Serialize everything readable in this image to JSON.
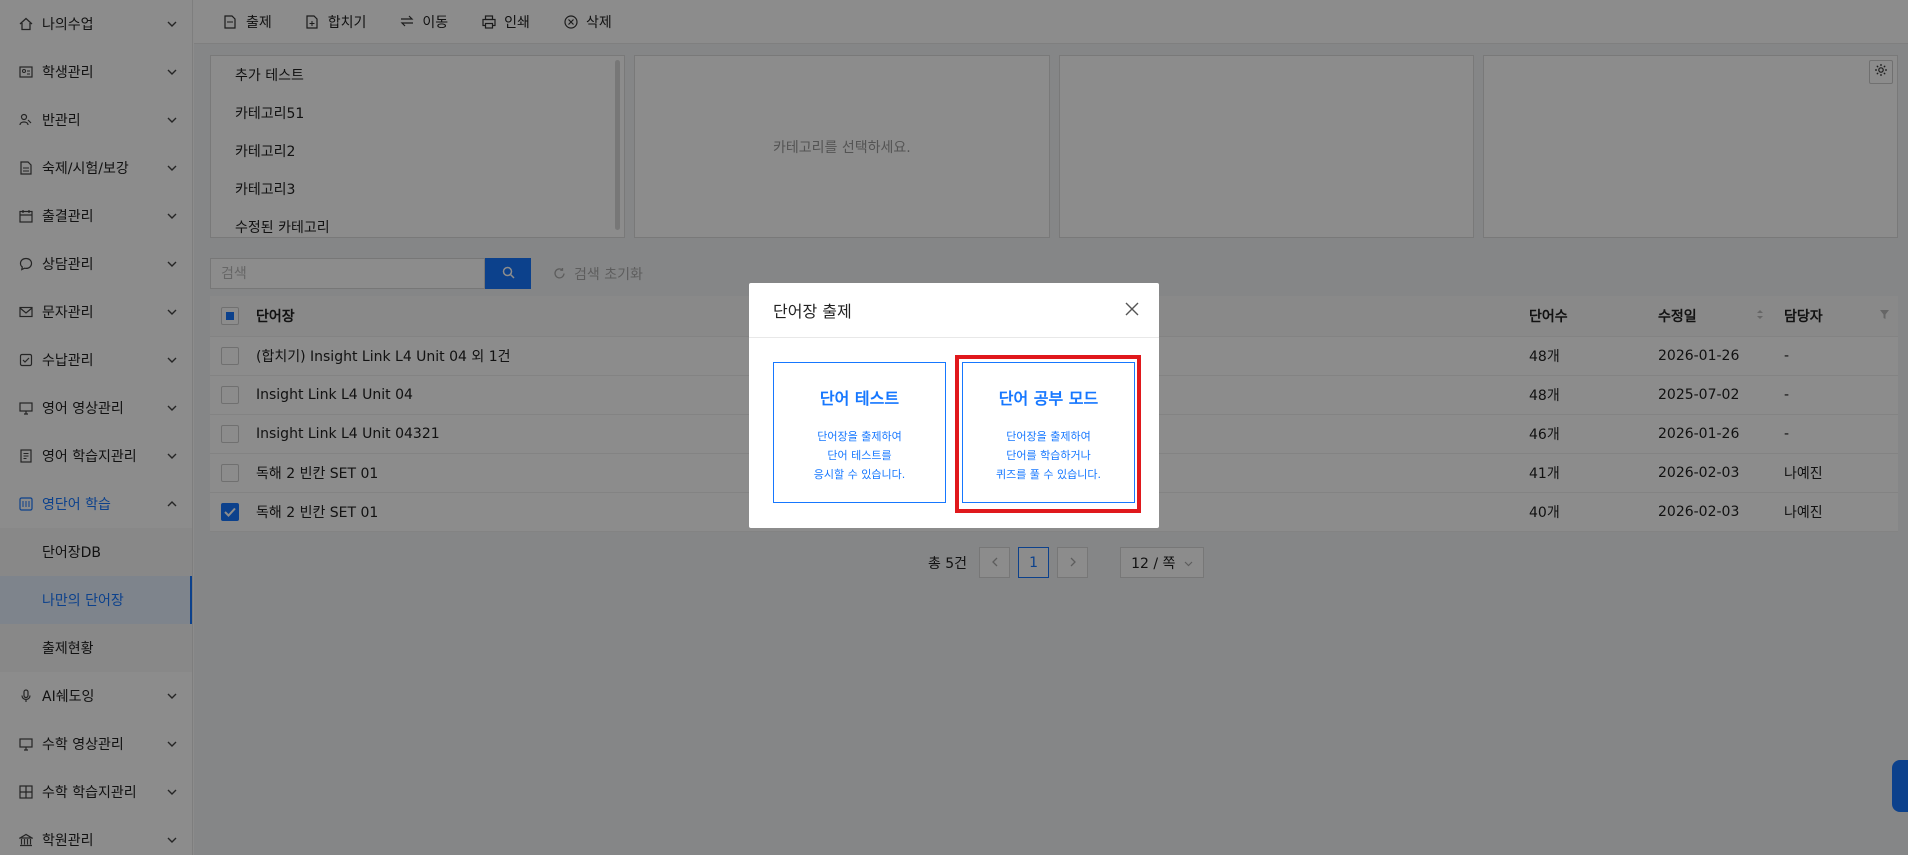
{
  "sidebar": {
    "items": [
      {
        "label": "나의수업",
        "icon": "home-icon"
      },
      {
        "label": "학생관리",
        "icon": "id-card-icon"
      },
      {
        "label": "반관리",
        "icon": "users-icon"
      },
      {
        "label": "숙제/시험/보강",
        "icon": "document-icon"
      },
      {
        "label": "출결관리",
        "icon": "calendar-icon"
      },
      {
        "label": "상담관리",
        "icon": "chat-icon"
      },
      {
        "label": "문자관리",
        "icon": "mail-icon"
      },
      {
        "label": "수납관리",
        "icon": "receipt-icon"
      },
      {
        "label": "영어 영상관리",
        "icon": "monitor-icon"
      },
      {
        "label": "영어 학습지관리",
        "icon": "book-icon"
      },
      {
        "label": "영단어 학습",
        "icon": "vocab-icon"
      }
    ],
    "subitems": [
      "단어장DB",
      "나만의 단어장",
      "출제현황"
    ],
    "items_after": [
      {
        "label": "AI쉐도잉",
        "icon": "mic-icon"
      },
      {
        "label": "수학 영상관리",
        "icon": "monitor-icon"
      },
      {
        "label": "수학 학습지관리",
        "icon": "grid-icon"
      },
      {
        "label": "학원관리",
        "icon": "building-icon"
      }
    ]
  },
  "toolbar": {
    "assign": "출제",
    "merge": "합치기",
    "move": "이동",
    "print": "인쇄",
    "delete": "삭제"
  },
  "categories": [
    "추가 테스트",
    "카테고리51",
    "카테고리2",
    "카테고리3",
    "수정된 카테고리"
  ],
  "category_placeholder": "카테고리를 선택하세요.",
  "search": {
    "placeholder": "검색",
    "reset": "검색 초기화"
  },
  "table": {
    "headers": {
      "name": "단어장",
      "count": "단어수",
      "date": "수정일",
      "owner": "담당자"
    },
    "rows": [
      {
        "name": "(합치기) Insight Link L4 Unit 04 외 1건",
        "count": "48개",
        "date": "2026-01-26",
        "owner": "-"
      },
      {
        "name": "Insight Link L4 Unit 04",
        "count": "48개",
        "date": "2025-07-02",
        "owner": "-"
      },
      {
        "name": "Insight Link L4 Unit 04321",
        "count": "46개",
        "date": "2026-01-26",
        "owner": "-"
      },
      {
        "name": "독해 2 빈칸 SET 01",
        "count": "41개",
        "date": "2026-02-03",
        "owner": "나예진"
      },
      {
        "name": "독해 2 빈칸 SET 01",
        "count": "40개",
        "date": "2026-02-03",
        "owner": "나예진"
      }
    ]
  },
  "pagination": {
    "total": "총 5건",
    "current": "1",
    "page_size": "12 / 쪽"
  },
  "modal": {
    "title": "단어장 출제",
    "option1": {
      "title": "단어 테스트",
      "line1": "단어장을 출제하여",
      "line2": "단어 테스트를",
      "line3": "응시할 수 있습니다."
    },
    "option2": {
      "title": "단어 공부 모드",
      "line1": "단어장을 출제하여",
      "line2": "단어를 학습하거나",
      "line3": "퀴즈를 풀 수 있습니다."
    }
  },
  "colors": {
    "accent": "#1677ff",
    "highlight": "#e0181c",
    "overlay": "rgba(0,0,0,0.45)"
  }
}
